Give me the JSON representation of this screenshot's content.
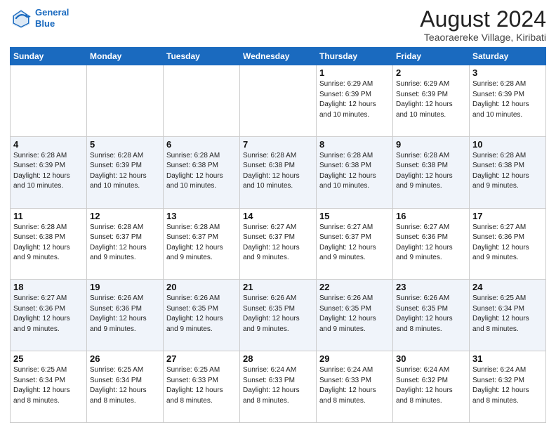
{
  "header": {
    "logo_line1": "General",
    "logo_line2": "Blue",
    "main_title": "August 2024",
    "subtitle": "Teaoraereke Village, Kiribati"
  },
  "days_of_week": [
    "Sunday",
    "Monday",
    "Tuesday",
    "Wednesday",
    "Thursday",
    "Friday",
    "Saturday"
  ],
  "weeks": [
    [
      {
        "day": "",
        "info": ""
      },
      {
        "day": "",
        "info": ""
      },
      {
        "day": "",
        "info": ""
      },
      {
        "day": "",
        "info": ""
      },
      {
        "day": "1",
        "info": "Sunrise: 6:29 AM\nSunset: 6:39 PM\nDaylight: 12 hours\nand 10 minutes."
      },
      {
        "day": "2",
        "info": "Sunrise: 6:29 AM\nSunset: 6:39 PM\nDaylight: 12 hours\nand 10 minutes."
      },
      {
        "day": "3",
        "info": "Sunrise: 6:28 AM\nSunset: 6:39 PM\nDaylight: 12 hours\nand 10 minutes."
      }
    ],
    [
      {
        "day": "4",
        "info": "Sunrise: 6:28 AM\nSunset: 6:39 PM\nDaylight: 12 hours\nand 10 minutes."
      },
      {
        "day": "5",
        "info": "Sunrise: 6:28 AM\nSunset: 6:39 PM\nDaylight: 12 hours\nand 10 minutes."
      },
      {
        "day": "6",
        "info": "Sunrise: 6:28 AM\nSunset: 6:38 PM\nDaylight: 12 hours\nand 10 minutes."
      },
      {
        "day": "7",
        "info": "Sunrise: 6:28 AM\nSunset: 6:38 PM\nDaylight: 12 hours\nand 10 minutes."
      },
      {
        "day": "8",
        "info": "Sunrise: 6:28 AM\nSunset: 6:38 PM\nDaylight: 12 hours\nand 10 minutes."
      },
      {
        "day": "9",
        "info": "Sunrise: 6:28 AM\nSunset: 6:38 PM\nDaylight: 12 hours\nand 9 minutes."
      },
      {
        "day": "10",
        "info": "Sunrise: 6:28 AM\nSunset: 6:38 PM\nDaylight: 12 hours\nand 9 minutes."
      }
    ],
    [
      {
        "day": "11",
        "info": "Sunrise: 6:28 AM\nSunset: 6:38 PM\nDaylight: 12 hours\nand 9 minutes."
      },
      {
        "day": "12",
        "info": "Sunrise: 6:28 AM\nSunset: 6:37 PM\nDaylight: 12 hours\nand 9 minutes."
      },
      {
        "day": "13",
        "info": "Sunrise: 6:28 AM\nSunset: 6:37 PM\nDaylight: 12 hours\nand 9 minutes."
      },
      {
        "day": "14",
        "info": "Sunrise: 6:27 AM\nSunset: 6:37 PM\nDaylight: 12 hours\nand 9 minutes."
      },
      {
        "day": "15",
        "info": "Sunrise: 6:27 AM\nSunset: 6:37 PM\nDaylight: 12 hours\nand 9 minutes."
      },
      {
        "day": "16",
        "info": "Sunrise: 6:27 AM\nSunset: 6:36 PM\nDaylight: 12 hours\nand 9 minutes."
      },
      {
        "day": "17",
        "info": "Sunrise: 6:27 AM\nSunset: 6:36 PM\nDaylight: 12 hours\nand 9 minutes."
      }
    ],
    [
      {
        "day": "18",
        "info": "Sunrise: 6:27 AM\nSunset: 6:36 PM\nDaylight: 12 hours\nand 9 minutes."
      },
      {
        "day": "19",
        "info": "Sunrise: 6:26 AM\nSunset: 6:36 PM\nDaylight: 12 hours\nand 9 minutes."
      },
      {
        "day": "20",
        "info": "Sunrise: 6:26 AM\nSunset: 6:35 PM\nDaylight: 12 hours\nand 9 minutes."
      },
      {
        "day": "21",
        "info": "Sunrise: 6:26 AM\nSunset: 6:35 PM\nDaylight: 12 hours\nand 9 minutes."
      },
      {
        "day": "22",
        "info": "Sunrise: 6:26 AM\nSunset: 6:35 PM\nDaylight: 12 hours\nand 9 minutes."
      },
      {
        "day": "23",
        "info": "Sunrise: 6:26 AM\nSunset: 6:35 PM\nDaylight: 12 hours\nand 8 minutes."
      },
      {
        "day": "24",
        "info": "Sunrise: 6:25 AM\nSunset: 6:34 PM\nDaylight: 12 hours\nand 8 minutes."
      }
    ],
    [
      {
        "day": "25",
        "info": "Sunrise: 6:25 AM\nSunset: 6:34 PM\nDaylight: 12 hours\nand 8 minutes."
      },
      {
        "day": "26",
        "info": "Sunrise: 6:25 AM\nSunset: 6:34 PM\nDaylight: 12 hours\nand 8 minutes."
      },
      {
        "day": "27",
        "info": "Sunrise: 6:25 AM\nSunset: 6:33 PM\nDaylight: 12 hours\nand 8 minutes."
      },
      {
        "day": "28",
        "info": "Sunrise: 6:24 AM\nSunset: 6:33 PM\nDaylight: 12 hours\nand 8 minutes."
      },
      {
        "day": "29",
        "info": "Sunrise: 6:24 AM\nSunset: 6:33 PM\nDaylight: 12 hours\nand 8 minutes."
      },
      {
        "day": "30",
        "info": "Sunrise: 6:24 AM\nSunset: 6:32 PM\nDaylight: 12 hours\nand 8 minutes."
      },
      {
        "day": "31",
        "info": "Sunrise: 6:24 AM\nSunset: 6:32 PM\nDaylight: 12 hours\nand 8 minutes."
      }
    ]
  ]
}
